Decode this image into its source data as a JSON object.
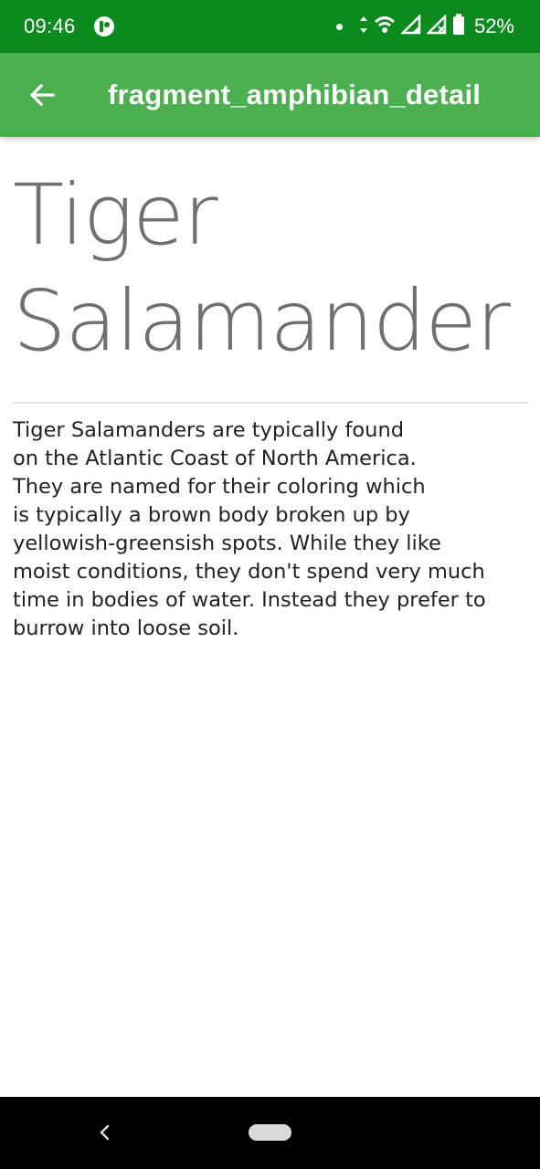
{
  "status_bar": {
    "time": "09:46",
    "battery": "52%",
    "icons": [
      "app-notification-icon",
      "dot-icon",
      "data-arrows-icon",
      "wifi-icon",
      "signal-icon",
      "signal-no-service-icon",
      "battery-icon"
    ]
  },
  "app_bar": {
    "title": "fragment_amphibian_detail",
    "back_icon": "arrow-left-icon",
    "color": "#4caf50"
  },
  "detail": {
    "title": "Tiger\nSalamander",
    "description": "Tiger Salamanders are typically found\non the Atlantic Coast of North America.\nThey are named for their coloring which\nis typically a brown body broken up by\nyellowish-greensish spots. While they like\nmoist conditions, they don't spend very much\ntime in bodies of water. Instead they prefer to\nburrow into loose soil."
  },
  "nav_bar": {
    "back_icon": "chevron-left-icon",
    "home_icon": "home-pill-icon"
  },
  "colors": {
    "status_bar": "#0d8a1e",
    "app_bar": "#4caf50",
    "title_text": "#707070",
    "body_text": "#222222"
  }
}
